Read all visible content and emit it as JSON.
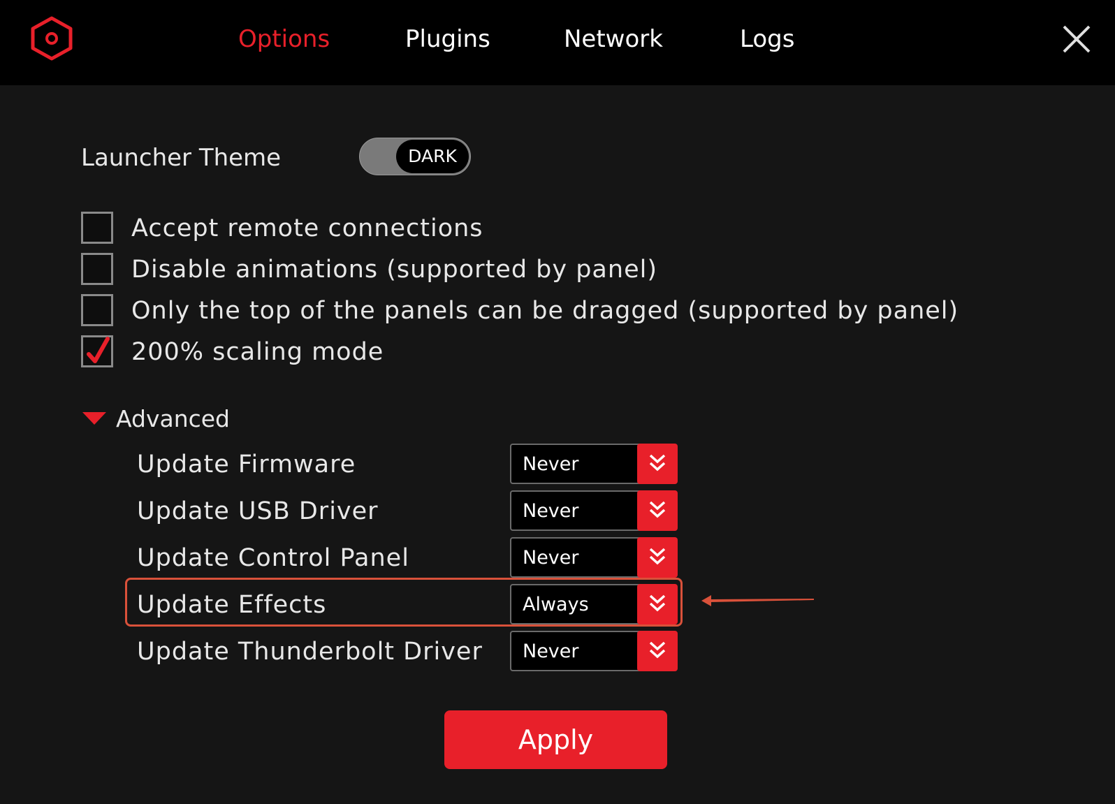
{
  "colors": {
    "accent": "#e8202a",
    "background": "#151515",
    "topbar": "#000000",
    "annotation": "#d9513a"
  },
  "header": {
    "logo_icon": "hexagon-logo-icon",
    "close_icon": "close-icon",
    "tabs": [
      {
        "label": "Options",
        "active": true
      },
      {
        "label": "Plugins",
        "active": false
      },
      {
        "label": "Network",
        "active": false
      },
      {
        "label": "Logs",
        "active": false
      }
    ]
  },
  "options": {
    "theme_label": "Launcher Theme",
    "theme_value": "DARK",
    "checkboxes": [
      {
        "label": "Accept remote connections",
        "checked": false
      },
      {
        "label": "Disable animations (supported by panel)",
        "checked": false
      },
      {
        "label": "Only the top of the panels can be dragged (supported by panel)",
        "checked": false
      },
      {
        "label": "200% scaling mode",
        "checked": true
      }
    ]
  },
  "advanced": {
    "label": "Advanced",
    "expanded": true,
    "settings": [
      {
        "label": "Update Firmware",
        "value": "Never"
      },
      {
        "label": "Update USB Driver",
        "value": "Never"
      },
      {
        "label": "Update Control Panel",
        "value": "Never"
      },
      {
        "label": "Update Effects",
        "value": "Always",
        "highlighted": true
      },
      {
        "label": "Update Thunderbolt Driver",
        "value": "Never"
      }
    ]
  },
  "footer": {
    "apply_label": "Apply"
  }
}
